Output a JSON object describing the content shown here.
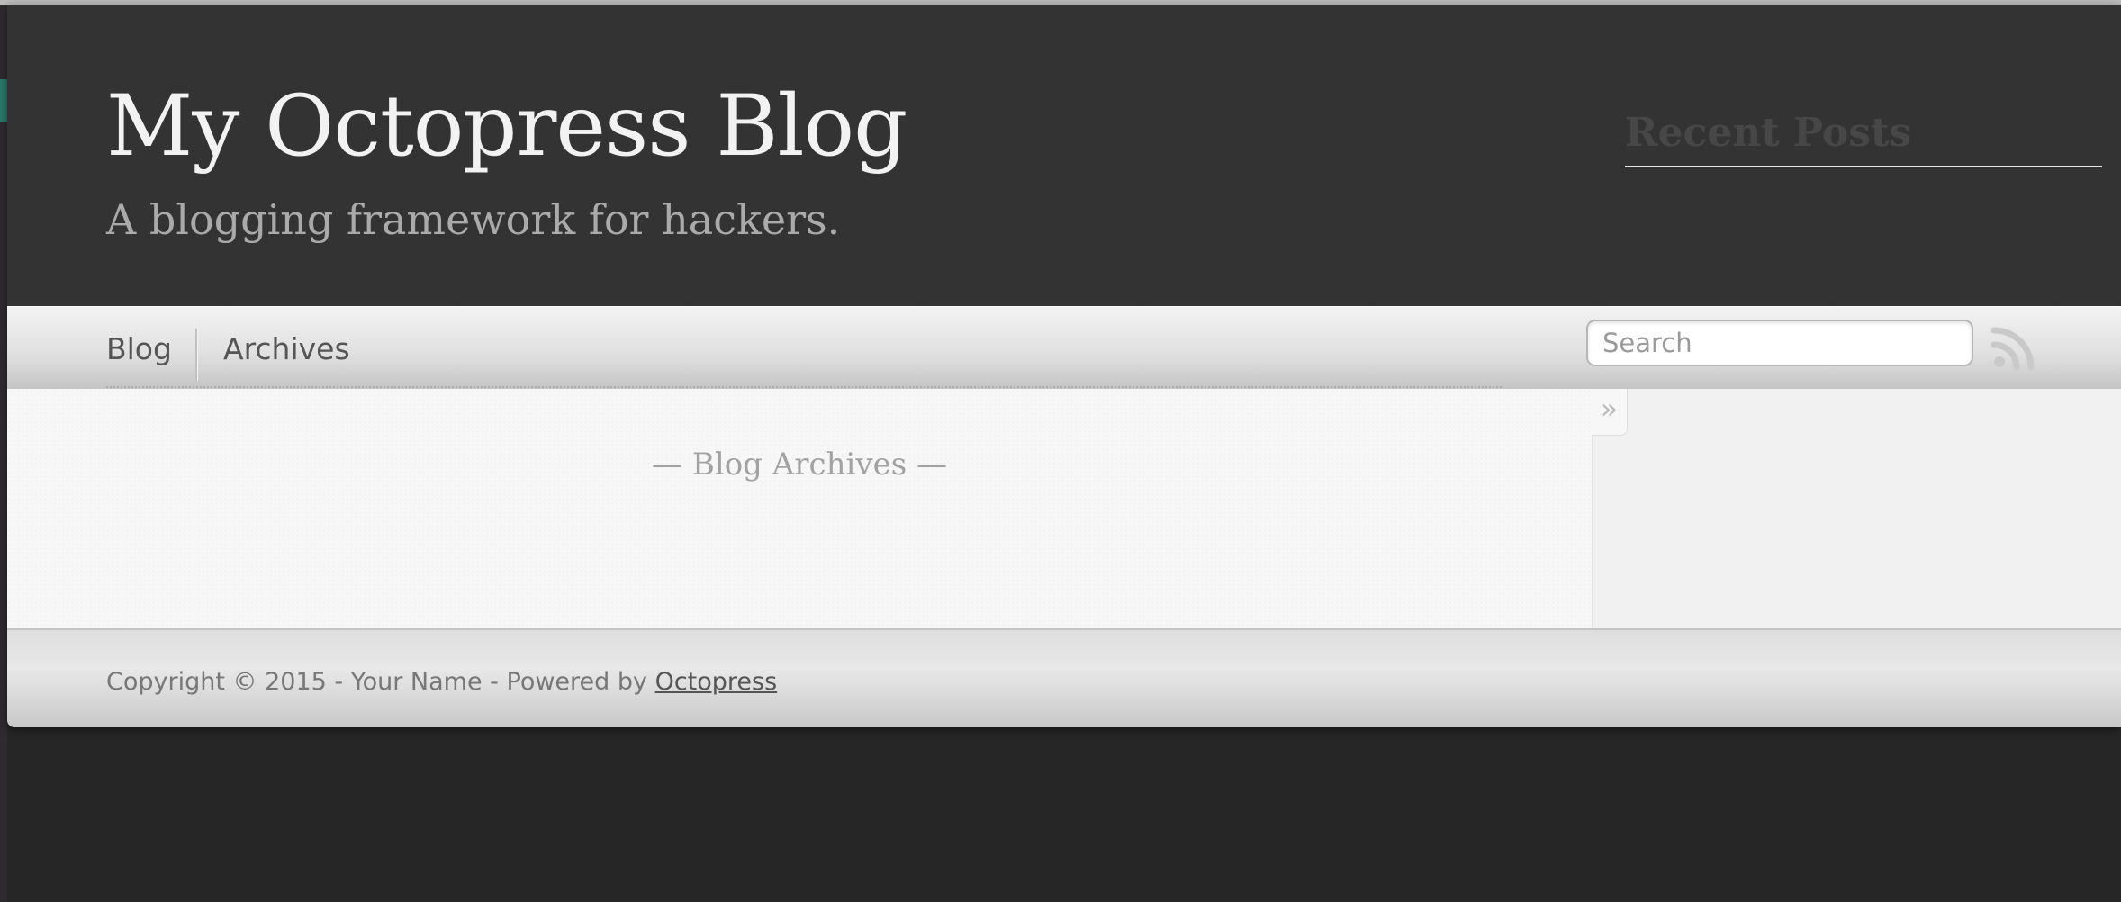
{
  "site": {
    "title": "My Octopress Blog",
    "subtitle": "A blogging framework for hackers."
  },
  "nav": {
    "items": [
      {
        "label": "Blog"
      },
      {
        "label": "Archives"
      }
    ],
    "search": {
      "placeholder": "Search",
      "value": ""
    },
    "rss_icon": "rss-icon"
  },
  "main": {
    "heading": "— Blog Archives —"
  },
  "sidebar": {
    "toggle_label": "»",
    "recent_posts_heading": "Recent Posts"
  },
  "footer": {
    "copyright_text": "Copyright © 2015 - Your Name - Powered by ",
    "link_label": "Octopress"
  },
  "colors": {
    "header_bg": "#333333",
    "title": "#f2f2f2",
    "subtitle": "#aaaaaa",
    "page_bg": "#262626"
  }
}
